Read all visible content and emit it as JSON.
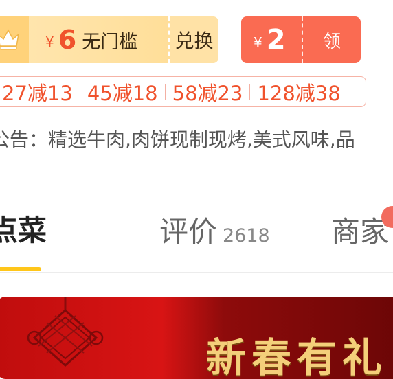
{
  "coupons": {
    "gold": {
      "currency": "¥",
      "amount": "6",
      "description": "无门槛",
      "action": "兑换"
    },
    "red": {
      "currency": "¥",
      "amount": "2",
      "action": "领"
    }
  },
  "discount_tiers": [
    "27减13",
    "45减18",
    "58减23",
    "128减38"
  ],
  "notice": {
    "text": "公告：精选牛肉,肉饼现制现烤,美式风味,品"
  },
  "tabs": {
    "order": "点菜",
    "reviews": {
      "label": "评价",
      "count": "2618"
    },
    "merchant": "商家"
  },
  "banner": {
    "text": "新春有礼"
  },
  "colors": {
    "accent_orange": "#f0522c",
    "coupon_gold_bg": "#ffdc92",
    "coupon_red_bg": "#fa6b52",
    "tab_underline": "#ffc61a",
    "banner_red": "#c00d0d",
    "banner_gold_text": "#f4cf7a"
  },
  "icons": [
    "crown-icon",
    "chinese-knot-icon"
  ]
}
